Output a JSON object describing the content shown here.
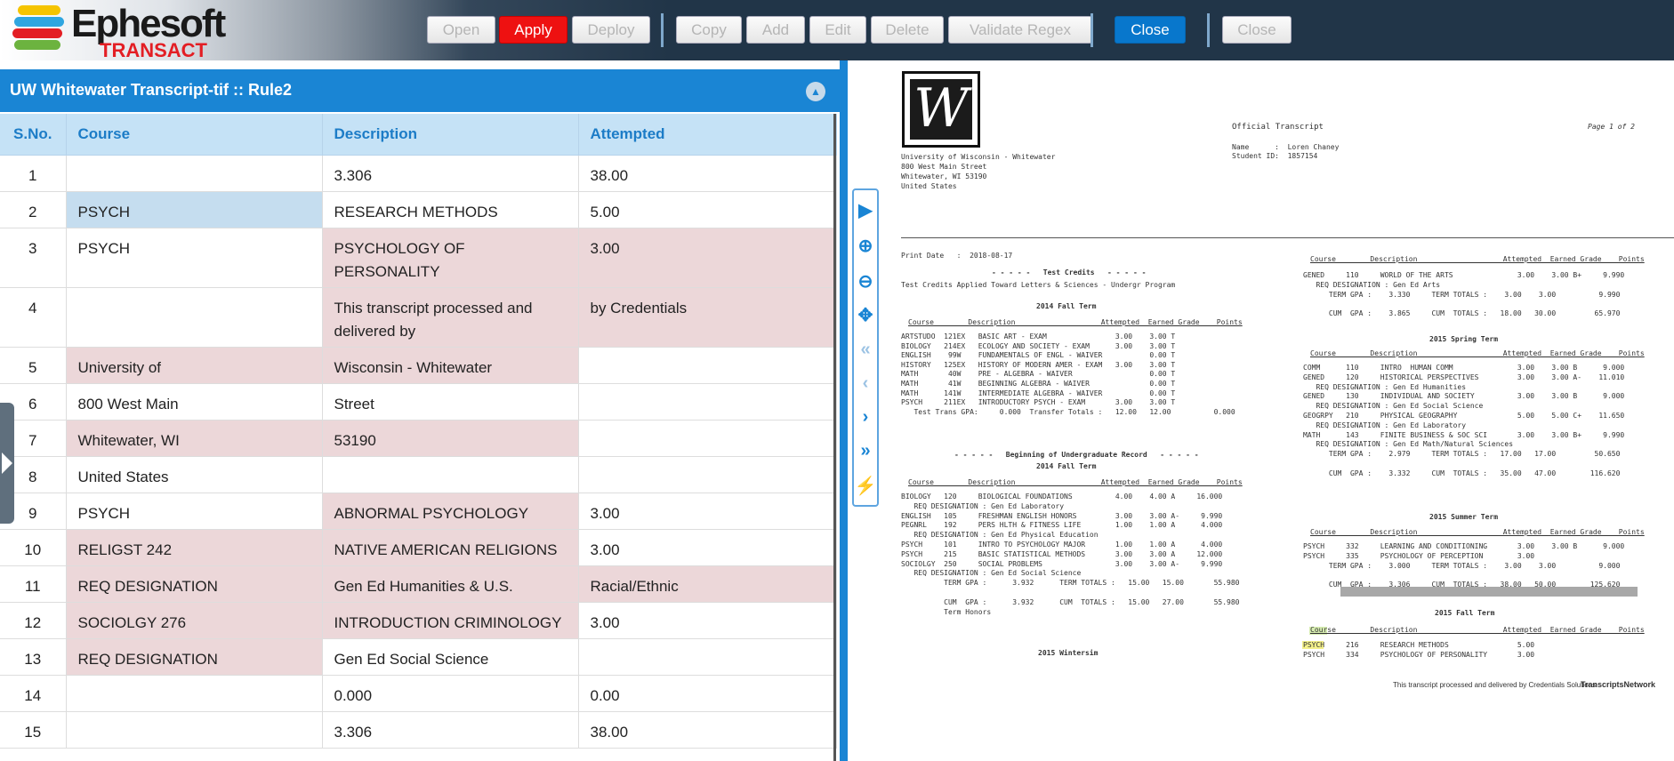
{
  "header": {
    "logo_word": "Ephesoft",
    "logo_sub": "TRANSACT",
    "logo_colors": [
      "#f5c400",
      "#2fa6e0",
      "#e31e24",
      "#6cb33f"
    ],
    "buttons": {
      "open": "Open",
      "apply": "Apply",
      "deploy": "Deploy",
      "copy": "Copy",
      "add": "Add",
      "edit": "Edit",
      "delete": "Delete",
      "validate_regex": "Validate Regex",
      "close_primary": "Close",
      "close_secondary": "Close"
    }
  },
  "panel": {
    "title": "UW Whitewater Transcript-tif :: Rule2",
    "collapse_icon": "chevron-up-icon"
  },
  "table": {
    "headers": [
      "S.No.",
      "Course",
      "Description",
      "Attempted"
    ],
    "rows": [
      {
        "n": "1",
        "course": "",
        "desc": "3.306",
        "att": "38.00",
        "h": 41,
        "hl": [
          "",
          "",
          "",
          ""
        ]
      },
      {
        "n": "2",
        "course": "PSYCH",
        "desc": "RESEARCH METHODS",
        "att": "5.00",
        "h": 41,
        "hl": [
          "",
          "blue",
          "",
          ""
        ]
      },
      {
        "n": "3",
        "course": "PSYCH",
        "desc": "PSYCHOLOGY OF PERSONALITY",
        "att": "3.00",
        "h": 67,
        "hl": [
          "",
          "",
          "pink",
          "pink"
        ]
      },
      {
        "n": "4",
        "course": "",
        "desc": "This transcript processed and delivered by",
        "att": "by Credentials",
        "h": 67,
        "hl": [
          "",
          "",
          "pink",
          "pink"
        ]
      },
      {
        "n": "5",
        "course": "University of",
        "desc": "Wisconsin - Whitewater",
        "att": "",
        "h": 41,
        "hl": [
          "",
          "pink",
          "pink",
          ""
        ]
      },
      {
        "n": "6",
        "course": "800 West Main",
        "desc": "Street",
        "att": "",
        "h": 41,
        "hl": [
          "",
          "",
          "",
          ""
        ]
      },
      {
        "n": "7",
        "course": "Whitewater, WI",
        "desc": "53190",
        "att": "",
        "h": 41,
        "hl": [
          "",
          "pink",
          "pink",
          ""
        ]
      },
      {
        "n": "8",
        "course": "United States",
        "desc": "",
        "att": "",
        "h": 41,
        "hl": [
          "",
          "",
          "",
          ""
        ]
      },
      {
        "n": "9",
        "course": "PSYCH",
        "desc": "ABNORMAL PSYCHOLOGY",
        "att": "3.00",
        "h": 41,
        "hl": [
          "",
          "",
          "pink",
          ""
        ]
      },
      {
        "n": "10",
        "course": "RELIGST 242",
        "desc": "NATIVE AMERICAN RELIGIONS",
        "att": "3.00",
        "h": 41,
        "hl": [
          "",
          "pink",
          "pink",
          ""
        ]
      },
      {
        "n": "11",
        "course": "REQ DESIGNATION",
        "desc": "Gen Ed Humanities & U.S.",
        "att": "Racial/Ethnic",
        "h": 41,
        "hl": [
          "",
          "pink",
          "pink",
          "pink"
        ]
      },
      {
        "n": "12",
        "course": "SOCIOLGY 276",
        "desc": "INTRODUCTION CRIMINOLOGY",
        "att": "3.00",
        "h": 41,
        "hl": [
          "",
          "pink",
          "pink",
          ""
        ]
      },
      {
        "n": "13",
        "course": "REQ DESIGNATION",
        "desc": "Gen Ed Social Science",
        "att": "",
        "h": 41,
        "hl": [
          "",
          "pink",
          "",
          ""
        ]
      },
      {
        "n": "14",
        "course": "",
        "desc": "0.000",
        "att": "0.00",
        "h": 41,
        "hl": [
          "",
          "",
          "",
          ""
        ]
      },
      {
        "n": "15",
        "course": "",
        "desc": "3.306",
        "att": "38.00",
        "h": 41,
        "hl": [
          "",
          "",
          "",
          ""
        ]
      }
    ]
  },
  "tools": [
    "play-icon",
    "zoom-in-icon",
    "zoom-out-icon",
    "move-icon",
    "first-page-icon",
    "previous-page-icon",
    "next-page-icon",
    "last-page-icon",
    "plug-icon"
  ],
  "document": {
    "seal_letter": "W",
    "page_indicator": "Page 1 of 2",
    "heading": "Official Transcript",
    "student_name_line": "Name      :  Loren Chaney",
    "student_id_line": "Student ID:  1857154",
    "address": [
      "University of Wisconsin - Whitewater",
      "800 West Main Street",
      "Whitewater, WI 53190",
      "United States"
    ],
    "print_date": "Print Date   :  2018-08-17",
    "test_credits_title": "- - - - -   Test Credits   - - - - -",
    "test_credits_note": "Test Credits Applied Toward Letters & Sciences - Undergr Program",
    "term_2014_fall": "2014 Fall Term",
    "col_headers": "Course        Description                    Attempted  Earned Grade    Points",
    "test_rows": [
      "ARTSTUDO  121EX   BASIC ART - EXAM                3.00    3.00 T",
      "BIOLOGY   214EX   ECOLOGY AND SOCIETY - EXAM      3.00    3.00 T",
      "ENGLISH    99W    FUNDAMENTALS OF ENGL - WAIVER           0.00 T",
      "HISTORY   125EX   HISTORY OF MODERN AMER - EXAM   3.00    3.00 T",
      "MATH       40W    PRE - ALGEBRA - WAIVER                  0.00 T",
      "MATH       41W    BEGINNING ALGEBRA - WAIVER              0.00 T",
      "MATH      141W    INTERMEDIATE ALGEBRA - WAIVER           0.00 T",
      "PSYCH     211EX   INTRODUCTORY PSYCH - EXAM       3.00    3.00 T",
      "   Test Trans GPA:     0.000  Transfer Totals :   12.00   12.00          0.000"
    ],
    "ugrad_title": "- - - - -   Beginning of Undergraduate Record   - - - - -",
    "ugrad_term": "2014 Fall Term",
    "ugrad_rows": [
      "BIOLOGY   120     BIOLOGICAL FOUNDATIONS          4.00    4.00 A     16.000",
      "   REQ DESIGNATION : Gen Ed Laboratory",
      "ENGLISH   105     FRESHMAN ENGLISH HONORS         3.00    3.00 A-     9.990",
      "PEGNRL    192     PERS HLTH & FITNESS LIFE        1.00    1.00 A      4.000",
      "   REQ DESIGNATION : Gen Ed Physical Education",
      "PSYCH     101     INTRO TO PSYCHOLOGY MAJOR       1.00    1.00 A      4.000",
      "PSYCH     215     BASIC STATISTICAL METHODS       3.00    3.00 A     12.000",
      "SOCIOLGY  250     SOCIAL PROBLEMS                 3.00    3.00 A-     9.990",
      "   REQ DESIGNATION : Gen Ed Social Science",
      "          TERM GPA :      3.932      TERM TOTALS :   15.00   15.00       55.980",
      "",
      "          CUM  GPA :      3.932      CUM  TOTALS :   15.00   27.00       55.980",
      "          Term Honors"
    ],
    "wintersim": "2015 Wintersim",
    "right_col_headers": "Course        Description                    Attempted  Earned Grade    Points",
    "right_block1": [
      "GENED     110     WORLD OF THE ARTS               3.00    3.00 B+     9.990",
      "   REQ DESIGNATION : Gen Ed Arts",
      "      TERM GPA :    3.330     TERM TOTALS :    3.00    3.00          9.990",
      "",
      "      CUM  GPA :    3.865     CUM  TOTALS :   18.00   30.00         65.970"
    ],
    "spring_term": "2015 Spring Term",
    "right_block2": [
      "COMM      110     INTRO  HUMAN COMM               3.00    3.00 B      9.000",
      "GENED     120     HISTORICAL PERSPECTIVES         3.00    3.00 A-    11.010",
      "   REQ DESIGNATION : Gen Ed Humanities",
      "GENED     130     INDIVIDUAL AND SOCIETY          3.00    3.00 B      9.000",
      "   REQ DESIGNATION : Gen Ed Social Science",
      "GEOGRPY   210     PHYSICAL GEOGRAPHY              5.00    5.00 C+    11.650",
      "   REQ DESIGNATION : Gen Ed Laboratory",
      "MATH      143     FINITE BUSINESS & SOC SCI       3.00    3.00 B+     9.990",
      "   REQ DESIGNATION : Gen Ed Math/Natural Sciences",
      "      TERM GPA :    2.979     TERM TOTALS :   17.00   17.00         50.650",
      "",
      "      CUM  GPA :    3.332     CUM  TOTALS :   35.00   47.00        116.620"
    ],
    "summer_term": "2015 Summer Term",
    "right_block3": [
      "PSYCH     332     LEARNING AND CONDITIONING       3.00    3.00 B      9.000",
      "PSYCH     335     PSYCHOLOGY OF PERCEPTION        3.00",
      "      TERM GPA :    3.000     TERM TOTALS :    3.00    3.00          9.000",
      "",
      "      CUM  GPA :    3.306     CUM  TOTALS :   38.00   50.00        125.620"
    ],
    "fall_2015": "2015 Fall Term",
    "right_block4": [
      "PSYCH     216     RESEARCH METHODS                5.00",
      "PSYCH     334     PSYCHOLOGY OF PERSONALITY       3.00"
    ],
    "footer_text": "This transcript processed and delivered by Credentials Solutions",
    "footer_brand": "TranscriptsNetwork"
  }
}
